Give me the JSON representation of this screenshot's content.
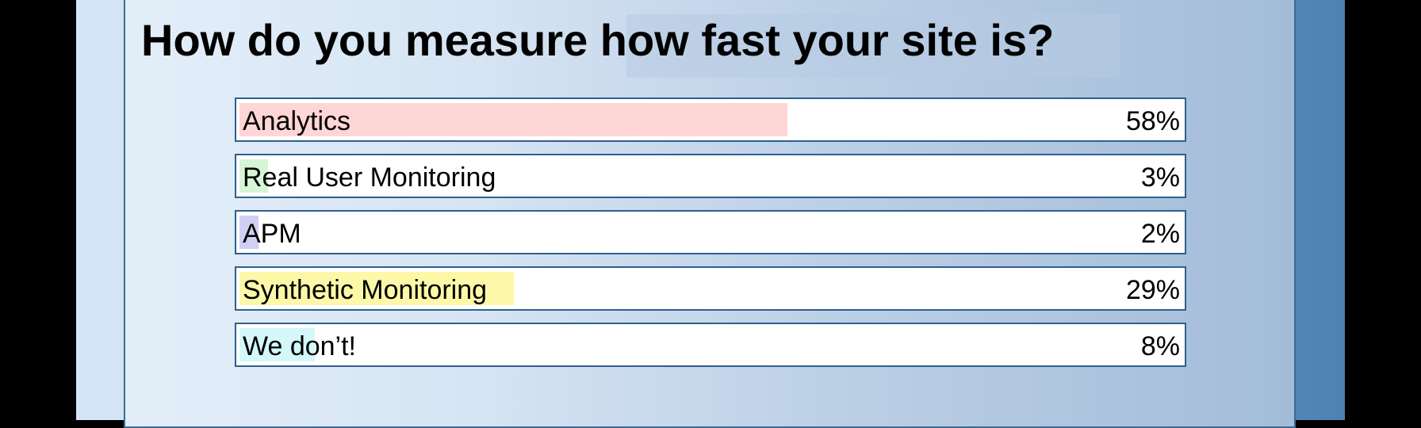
{
  "slide": {
    "title": "How do you measure how fast your site is?"
  },
  "chart_data": {
    "type": "bar",
    "title": "How do you measure how fast your site is?",
    "categories": [
      "Analytics",
      "Real User Monitoring",
      "APM",
      "Synthetic Monitoring",
      "We don’t!"
    ],
    "values": [
      58,
      3,
      2,
      29,
      8
    ],
    "value_labels": [
      "58%",
      "3%",
      "2%",
      "29%",
      "8%"
    ],
    "unit": "%",
    "ylim": [
      0,
      100
    ],
    "orientation": "horizontal",
    "colors": [
      "#ffd6d6",
      "#d6f5d6",
      "#d0d0f5",
      "#fcf8a8",
      "#d4f7f9"
    ],
    "legend": "none",
    "grid": false
  }
}
